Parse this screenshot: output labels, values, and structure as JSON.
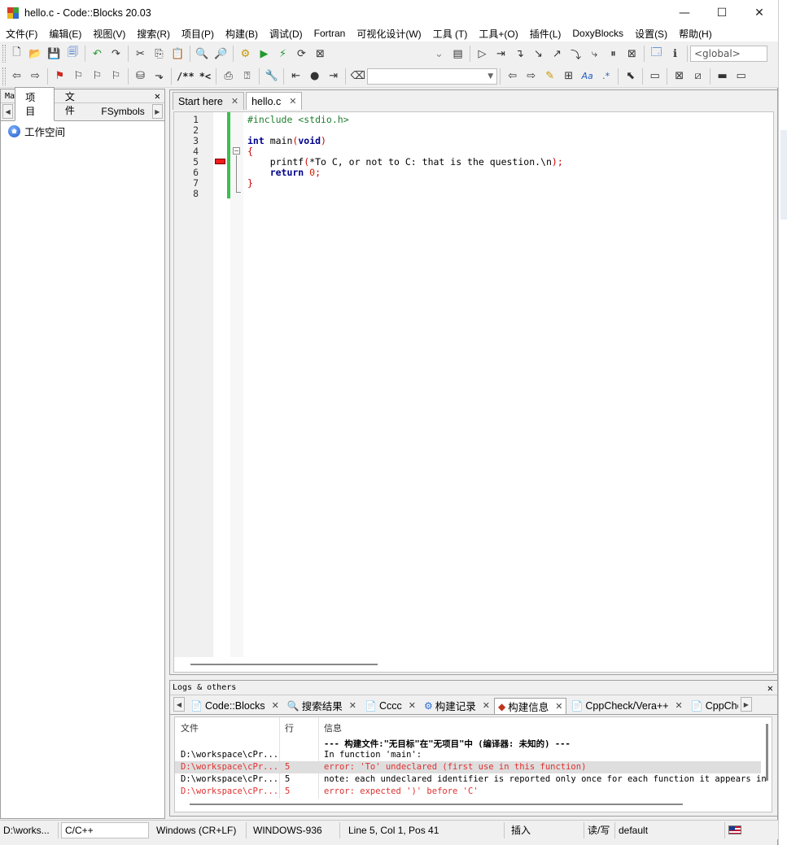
{
  "window": {
    "title": "hello.c - Code::Blocks 20.03",
    "minimize": "—",
    "maximize": "☐",
    "close": "✕"
  },
  "menu": [
    "文件(F)",
    "编辑(E)",
    "视图(V)",
    "搜索(R)",
    "项目(P)",
    "构建(B)",
    "调试(D)",
    "Fortran",
    "可视化设计(W)",
    "工具 (T)",
    "工具+(O)",
    "插件(L)",
    "DoxyBlocks",
    "设置(S)",
    "帮助(H)"
  ],
  "toolbar": {
    "scope_combo": "<global>",
    "doxy_comment_1": "/**",
    "doxy_comment_2": "*<",
    "regex_label": ".*",
    "aa_label": "Aa"
  },
  "management": {
    "title": "Management",
    "close": "✕",
    "tabs": [
      "项目",
      "文件",
      "FSymbols"
    ],
    "tree_root": "工作空间"
  },
  "editor": {
    "tabs": [
      {
        "label": "Start here",
        "close": "✕"
      },
      {
        "label": "hello.c",
        "close": "✕"
      }
    ],
    "line_numbers": [
      "1",
      "2",
      "3",
      "4",
      "5",
      "6",
      "7",
      "8"
    ],
    "fold_symbol": "−",
    "code": {
      "l1": "#include <stdio.h>",
      "l3_kw": "int",
      "l3_name": " main",
      "l3_paren_open": "(",
      "l3_void": "void",
      "l3_paren_close": ")",
      "l4": "{",
      "l5_fn": "    printf",
      "l5_open": "(",
      "l5_arg": "*To C, or not to C: that is the question.\\n",
      "l5_close": ");",
      "l6_kw": "    return",
      "l6_num": " 0",
      "l6_semi": ";",
      "l7": "}"
    }
  },
  "logs": {
    "title": "Logs & others",
    "close": "✕",
    "tabs": [
      {
        "icon": "📄",
        "label": "Code::Blocks",
        "close": "✕"
      },
      {
        "icon": "🔍",
        "label": "搜索结果",
        "close": "✕"
      },
      {
        "icon": "📄",
        "label": "Cccc",
        "close": "✕"
      },
      {
        "icon": "⚙",
        "label": "构建记录",
        "close": "✕"
      },
      {
        "icon": "◆",
        "label": "构建信息",
        "close": "✕"
      },
      {
        "icon": "📄",
        "label": "CppCheck/Vera++",
        "close": "✕"
      },
      {
        "icon": "📄",
        "label": "CppChe",
        "close": ""
      }
    ],
    "columns": [
      "文件",
      "行",
      "信息"
    ],
    "rows": [
      {
        "file": "",
        "line": "",
        "msg": "--- 构建文件:\"无目标\"在\"无项目\"中 (编译器: 未知的) ---"
      },
      {
        "file": "D:\\workspace\\cPr...",
        "line": "",
        "msg": "In function 'main':"
      },
      {
        "file": "D:\\workspace\\cPr...",
        "line": "5",
        "msg": "error: 'To' undeclared (first use in this function)"
      },
      {
        "file": "D:\\workspace\\cPr...",
        "line": "5",
        "msg": "note: each undeclared identifier is reported only once for each function it appears in"
      },
      {
        "file": "D:\\workspace\\cPr...",
        "line": "5",
        "msg": "error: expected ')' before 'C'"
      }
    ]
  },
  "status": {
    "path": "D:\\works...",
    "language": "C/C++",
    "eol": "Windows (CR+LF)",
    "encoding": "WINDOWS-936",
    "position": "Line 5, Col 1, Pos 41",
    "insert_mode": "插入",
    "rw_mode": "读/写",
    "profile": "default"
  }
}
